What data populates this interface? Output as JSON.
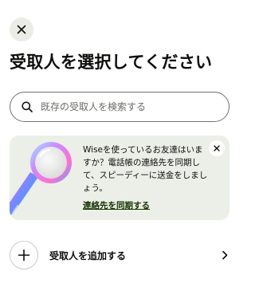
{
  "header": {
    "title": "受取人を選択してください",
    "close_icon": "close-icon"
  },
  "search": {
    "placeholder": "既存の受取人を検索する",
    "value": "",
    "icon": "search-icon"
  },
  "promo": {
    "text": "Wiseを使っているお友達はいますか？電話帳の連絡先を同期して、スピーディーに送金をしましょう。",
    "link_label": "連絡先を同期する",
    "illustration": "magnifying-glass-illustration",
    "close_icon": "close-icon"
  },
  "add_recipient": {
    "label": "受取人を追加する",
    "icon": "plus-icon",
    "trailing_icon": "chevron-right-icon"
  },
  "colors": {
    "text": "#0e0f0c",
    "card_background": "#eceee8",
    "button_background": "#ebece6",
    "link": "#163300",
    "border": "#6f7569"
  }
}
